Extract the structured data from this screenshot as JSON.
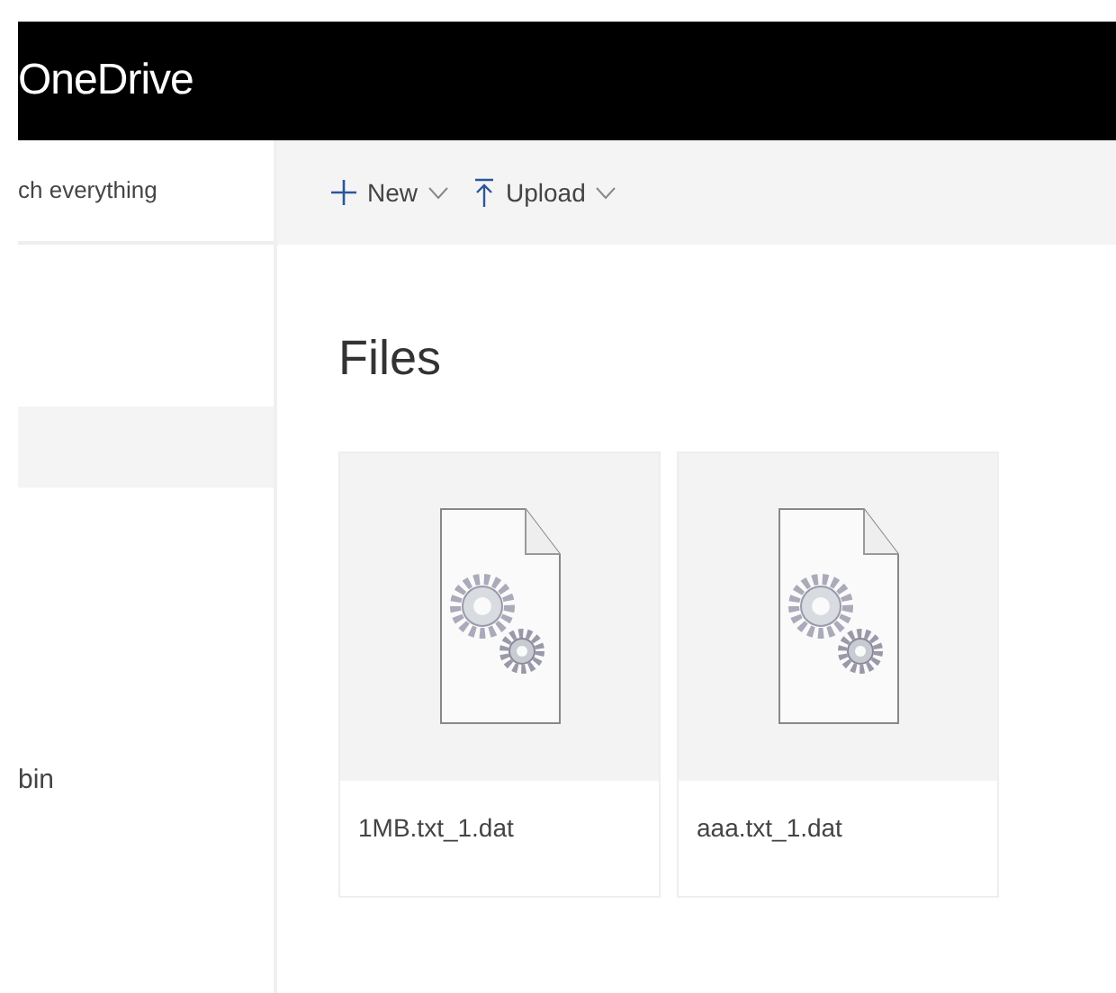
{
  "header": {
    "title": "OneDrive"
  },
  "sidebar": {
    "search": {
      "value": "ch everything"
    },
    "items": [
      {
        "label": "bin"
      }
    ]
  },
  "toolbar": {
    "buttons": [
      {
        "label": "New",
        "kind": "new"
      },
      {
        "label": "Upload",
        "kind": "upload"
      }
    ]
  },
  "main": {
    "heading": "Files",
    "files": [
      {
        "name": "1MB.txt_1.dat"
      },
      {
        "name": "aaa.txt_1.dat"
      }
    ]
  }
}
